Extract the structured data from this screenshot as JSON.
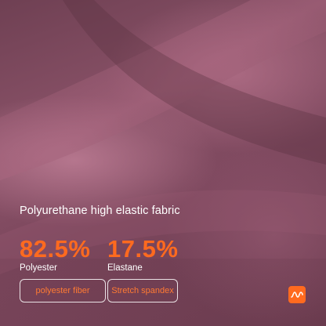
{
  "headline": "Polyurethane high elastic fabric",
  "stats": [
    {
      "value": "82.5%",
      "label": "Polyester"
    },
    {
      "value": "17.5%",
      "label": "Elastane"
    }
  ],
  "tags": [
    {
      "label": "polyester fiber"
    },
    {
      "label": "Stretch spandex"
    }
  ],
  "logo": {
    "icon": "brand-logo-icon"
  },
  "colors": {
    "accent": "#ff6a1f",
    "fabric": "#7c475d",
    "text": "#ffffff"
  }
}
